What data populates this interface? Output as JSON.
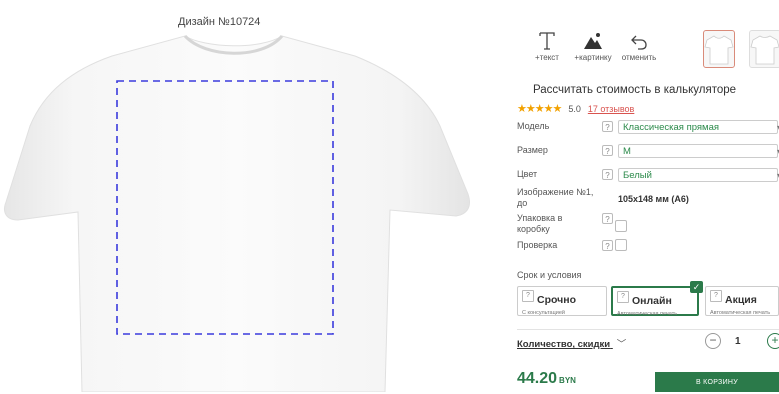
{
  "design_title": "Дизайн №10724",
  "toolbar": {
    "add_text": "+текст",
    "add_image": "+картинку",
    "undo": "отменить"
  },
  "calculator": {
    "title": "Рассчитать стоимость в калькуляторе",
    "stars": "★★★★★",
    "rating": "5.0",
    "reviews": "17 отзывов",
    "help_mark": "?",
    "rows": {
      "model": {
        "label": "Модель",
        "value": "Классическая прямая"
      },
      "size": {
        "label": "Размер",
        "value": "M"
      },
      "color": {
        "label": "Цвет",
        "value": "Белый"
      },
      "image": {
        "label_line1": "Изображение №1,",
        "label_line2": "до",
        "value": "105x148 мм (A6)"
      },
      "packaging": {
        "label_line1": "Упаковка в",
        "label_line2": "коробку"
      },
      "check": {
        "label": "Проверка"
      }
    },
    "terms_label": "Срок и условия",
    "options": [
      {
        "title": "Срочно",
        "subtitle": "С консультацией"
      },
      {
        "title": "Онлайн",
        "subtitle": "Автоматическая печать",
        "selected": true
      },
      {
        "title": "Акция",
        "subtitle": "Автоматическая печать"
      }
    ],
    "quantity_link": "Количество, скидки",
    "quantity": "1",
    "price": "44.20",
    "currency": "BYN",
    "cart_button": "В КОРЗИНУ"
  },
  "colors": {
    "accent": "#2b7a4a",
    "link": "#d9534f",
    "print_area": "#3b3bdd"
  }
}
